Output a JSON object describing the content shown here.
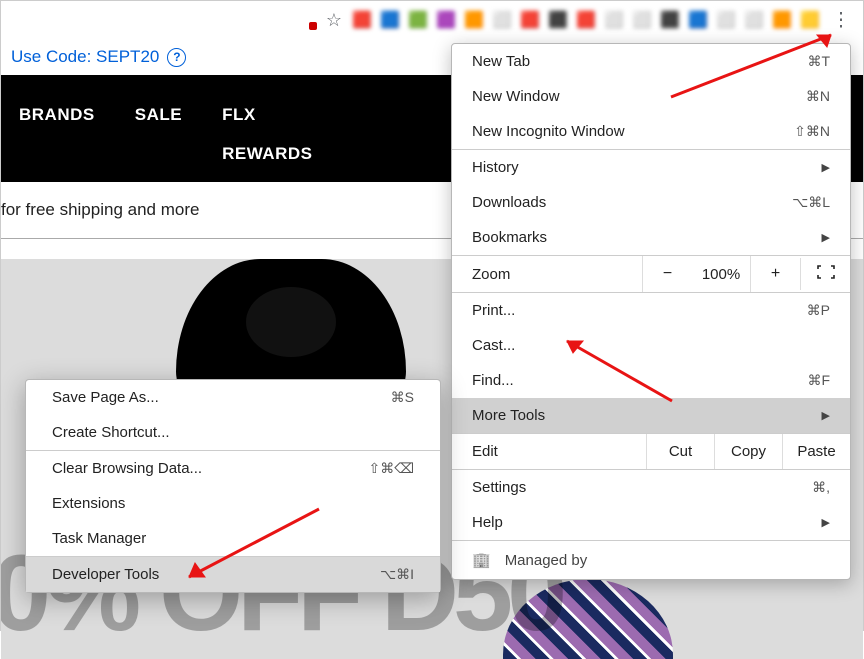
{
  "toolbar": {
    "extensions": [
      "🟥",
      "🟦",
      "🟩",
      "🟪",
      "🟧",
      "⬜",
      "🟥",
      "⬛",
      "🟥",
      "⬜",
      "⬜",
      "⬛",
      "🟦",
      "⬜",
      "⬜",
      "🟧",
      "🟨"
    ]
  },
  "promo": {
    "text": "Use Code: SEPT20"
  },
  "nav": {
    "brands": "BRANDS",
    "sale": "SALE",
    "flx1": "FLX",
    "flx2": "REWARDS"
  },
  "ship": {
    "text": "for free shipping and more"
  },
  "hero_text": "0% OFF D50",
  "menu": {
    "new_tab": {
      "label": "New Tab",
      "shortcut": "⌘T"
    },
    "new_window": {
      "label": "New Window",
      "shortcut": "⌘N"
    },
    "incognito": {
      "label": "New Incognito Window",
      "shortcut": "⇧⌘N"
    },
    "history": {
      "label": "History"
    },
    "downloads": {
      "label": "Downloads",
      "shortcut": "⌥⌘L"
    },
    "bookmarks": {
      "label": "Bookmarks"
    },
    "zoom": {
      "label": "Zoom",
      "pct": "100%"
    },
    "print": {
      "label": "Print...",
      "shortcut": "⌘P"
    },
    "cast": {
      "label": "Cast..."
    },
    "find": {
      "label": "Find...",
      "shortcut": "⌘F"
    },
    "more_tools": {
      "label": "More Tools"
    },
    "edit": {
      "label": "Edit",
      "cut": "Cut",
      "copy": "Copy",
      "paste": "Paste"
    },
    "settings": {
      "label": "Settings",
      "shortcut": "⌘,"
    },
    "help": {
      "label": "Help"
    },
    "managed": {
      "label": "Managed by"
    }
  },
  "submenu": {
    "save_as": {
      "label": "Save Page As...",
      "shortcut": "⌘S"
    },
    "shortcut": {
      "label": "Create Shortcut..."
    },
    "clear": {
      "label": "Clear Browsing Data...",
      "shortcut": "⇧⌘⌫"
    },
    "ext": {
      "label": "Extensions"
    },
    "task": {
      "label": "Task Manager"
    },
    "dev": {
      "label": "Developer Tools",
      "shortcut": "⌥⌘I"
    }
  }
}
